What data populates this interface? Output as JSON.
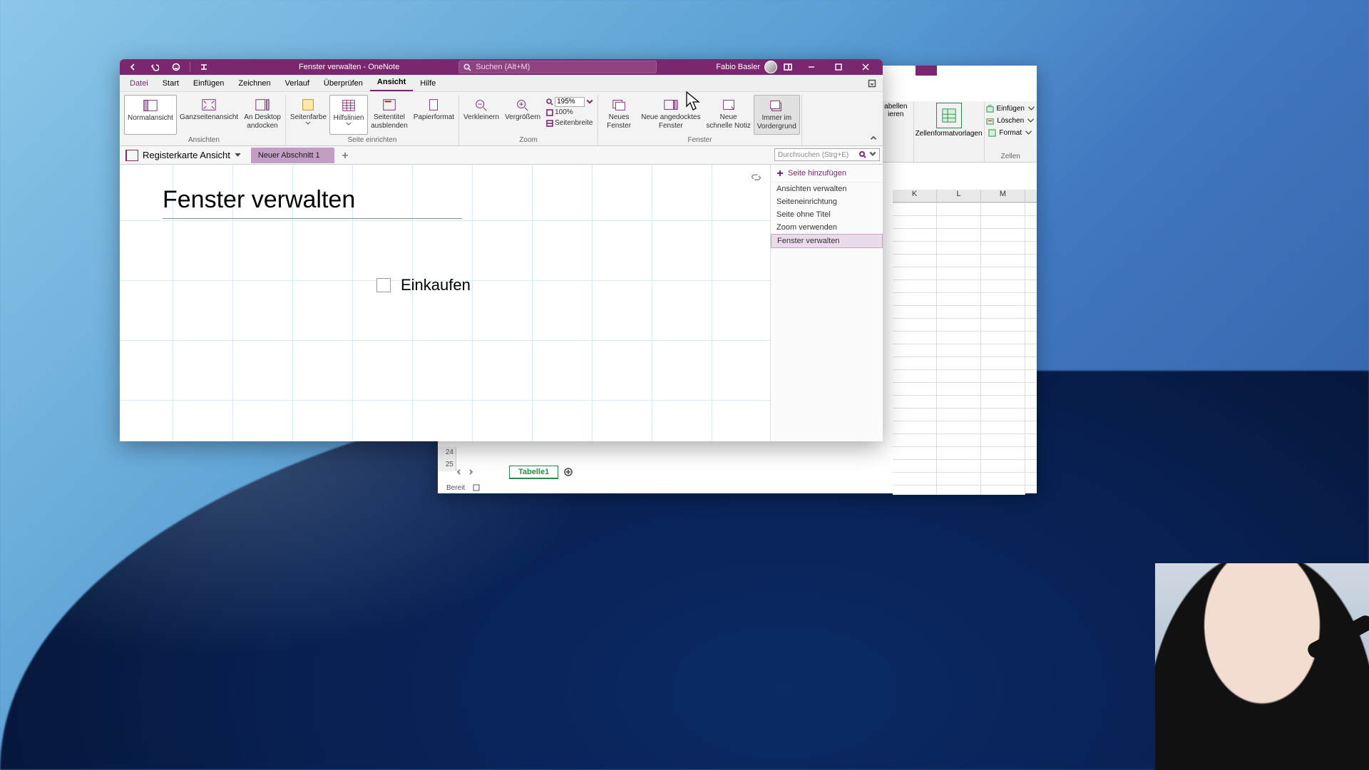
{
  "app": {
    "title": "Fenster verwalten  -  OneNote",
    "user": "Fabio Basler",
    "search_placeholder": "Suchen (Alt+M)"
  },
  "menus": [
    "Datei",
    "Start",
    "Einfügen",
    "Zeichnen",
    "Verlauf",
    "Überprüfen",
    "Ansicht",
    "Hilfe"
  ],
  "active_menu": "Ansicht",
  "ribbon": {
    "groups": {
      "ansichten": {
        "label": "Ansichten",
        "normal": "Normalansicht",
        "ganzseite": "Ganzseitenansicht",
        "andesktop": "An Desktop\nandocken"
      },
      "seite": {
        "label": "Seite einrichten",
        "seitenfarbe": "Seitenfarbe",
        "hilfslinien": "Hilfslinien",
        "seitentitel": "Seitentitel\nausblenden",
        "papierformat": "Papierformat"
      },
      "zoom": {
        "label": "Zoom",
        "verkleinern": "Verkleinern",
        "vergroessern": "Vergrößern",
        "value": "195%",
        "l100": "100%",
        "breite": "Seitenbreite"
      },
      "fenster": {
        "label": "Fenster",
        "neues": "Neues\nFenster",
        "angedockt": "Neue angedocktes\nFenster",
        "schnelle": "Neue\nschnelle Notiz",
        "immer": "Immer im\nVordergrund"
      }
    }
  },
  "notebook": {
    "name": "Registerkarte Ansicht",
    "section": "Neuer Abschnitt 1",
    "search_placeholder": "Durchsuchen (Strg+E)"
  },
  "page": {
    "title": "Fenster verwalten",
    "todo": "Einkaufen",
    "add_page": "Seite hinzufügen",
    "list": [
      "Ansichten verwalten",
      "Seiteneinrichtung",
      "Seite ohne Titel",
      "Zoom verwenden",
      "Fenster verwalten"
    ],
    "selected": "Fenster verwalten"
  },
  "excel": {
    "einfuegen": "Einfügen",
    "loeschen": "Löschen",
    "format": "Format",
    "ieren": "ieren",
    "abellen": "abellen",
    "zellen_label": "Zellen",
    "vorlagen": "Zellenformatvorlagen",
    "cols": [
      "K",
      "L",
      "M"
    ],
    "rows": [
      "24",
      "25"
    ],
    "sheet": "Tabelle1",
    "status": "Bereit"
  }
}
